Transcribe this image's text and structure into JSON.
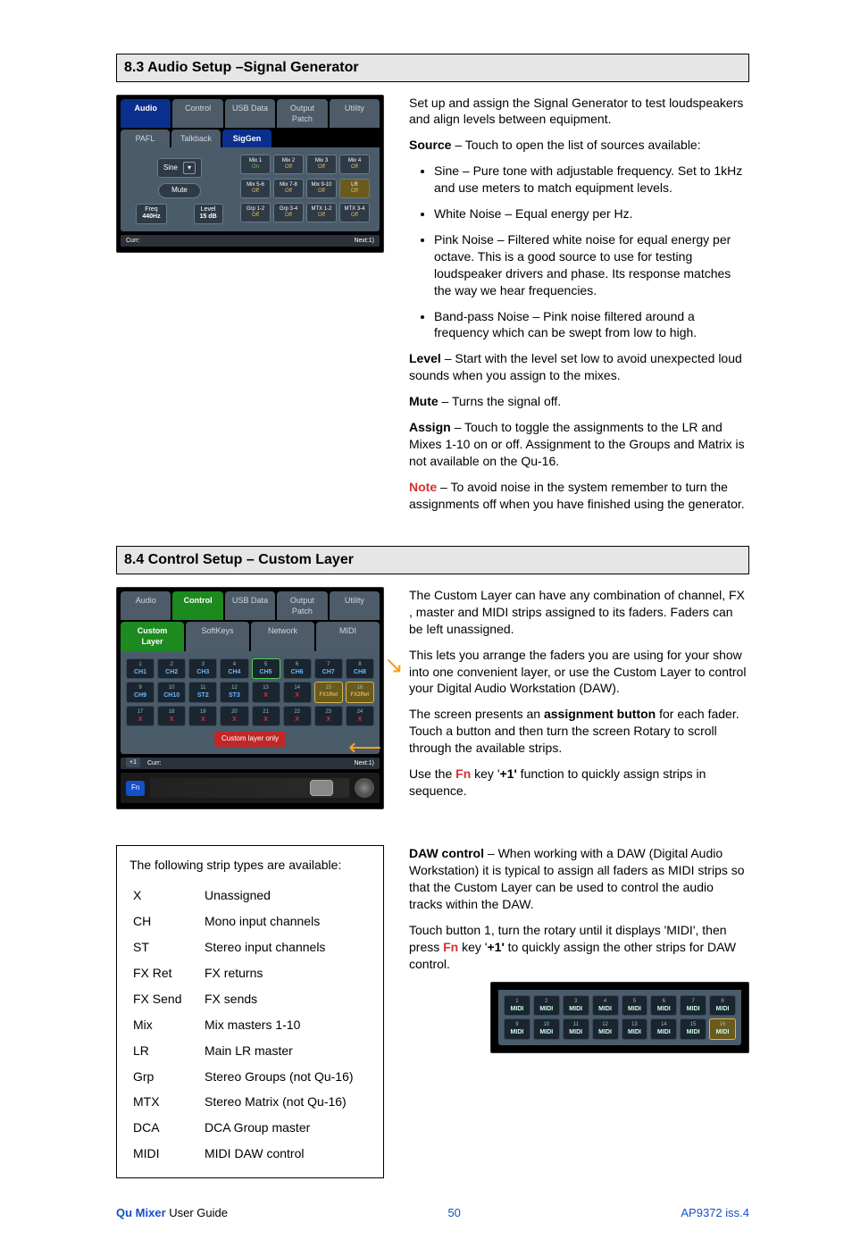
{
  "section83": {
    "heading": "8.3  Audio Setup –Signal Generator",
    "intro": "Set up and assign the Signal Generator to test loudspeakers and align levels between equipment.",
    "source_label": "Source",
    "source_text": " – Touch to open the list of sources available:",
    "bullets": [
      "Sine – Pure tone with adjustable frequency. Set to 1kHz and use meters to match equipment levels.",
      "White Noise – Equal energy per Hz.",
      "Pink Noise – Filtered white noise for equal energy per octave. This is a good source to use for testing loudspeaker drivers and phase. Its response matches the way we hear frequencies.",
      "Band-pass Noise – Pink noise filtered around a frequency which can be swept from low to high."
    ],
    "level_label": "Level",
    "level_text": " – Start with the level set low to avoid unexpected loud sounds when you assign to the mixes.",
    "mute_label": "Mute",
    "mute_text": " – Turns the signal off.",
    "assign_label": "Assign",
    "assign_text": " – Touch to toggle the assignments to the LR and Mixes 1-10 on or off. Assignment to the Groups and Matrix is not available on the Qu-16.",
    "note_label": "Note",
    "note_text": " – To avoid noise in the system remember to turn the assignments off when you have finished using the generator.",
    "ui": {
      "tabs_top": [
        "Audio",
        "Control",
        "USB Data",
        "Output Patch",
        "Utility"
      ],
      "tabs_sub": [
        "PAFL",
        "Talkback",
        "SigGen"
      ],
      "sine": "Sine",
      "mute": "Mute",
      "freq_label": "Freq",
      "freq_val": "440Hz",
      "level_label": "Level",
      "level_val": "15 dB",
      "mixes": [
        {
          "t": "Mix 1",
          "s": "On",
          "on": true
        },
        {
          "t": "Mix 2",
          "s": "Off",
          "on": false
        },
        {
          "t": "Mix 3",
          "s": "Off",
          "on": false
        },
        {
          "t": "Mix 4",
          "s": "Off",
          "on": false
        },
        {
          "t": "Mix 5-6",
          "s": "Off",
          "on": false
        },
        {
          "t": "Mix 7-8",
          "s": "Off",
          "on": false
        },
        {
          "t": "Mix 9-10",
          "s": "Off",
          "on": false
        },
        {
          "t": "LR",
          "s": "Off",
          "on": false,
          "lr": true
        },
        {
          "t": "Grp 1-2",
          "s": "Off",
          "on": false
        },
        {
          "t": "Grp 3-4",
          "s": "Off",
          "on": false
        },
        {
          "t": "MTX 1-2",
          "s": "Off",
          "on": false
        },
        {
          "t": "MTX 3-4",
          "s": "Off",
          "on": false
        }
      ],
      "footer_curr": "Curr:",
      "footer_next": "Next:1)"
    }
  },
  "section84": {
    "heading": "8.4  Control Setup – Custom Layer",
    "p1": "The Custom Layer can have any combination of channel, FX , master and MIDI strips assigned to its faders. Faders can be left unassigned.",
    "p2": "This lets you arrange the faders you are using for your show into one convenient layer, or use the Custom Layer to control your Digital Audio Workstation (DAW).",
    "p3a": "The screen presents an ",
    "p3b": "assignment button",
    "p3c": " for each fader. Touch a button and then turn the screen Rotary to scroll through the available strips.",
    "p4a": "Use the ",
    "p4_fn": "Fn",
    "p4b": " key '",
    "p4_plus": "+1'",
    "p4c": " function to quickly assign strips in sequence.",
    "daw_label": "DAW control",
    "daw_text": " – When working with a DAW (Digital Audio Workstation) it is typical to assign all faders as MIDI strips so that the Custom Layer can be used to control the audio tracks within the DAW.",
    "p6a": "Touch button 1, turn the rotary until it displays 'MIDI', then press ",
    "p6_fn": "Fn",
    "p6b": " key '",
    "p6_plus": "+1'",
    "p6c": " to quickly assign the other strips for DAW control.",
    "ui": {
      "tabs_top": [
        "Audio",
        "Control",
        "USB Data",
        "Output Patch",
        "Utility"
      ],
      "tabs_sub": [
        "Custom Layer",
        "SoftKeys",
        "Network",
        "MIDI"
      ],
      "cells": [
        {
          "n": "1",
          "l": "CH1",
          "c": "ch"
        },
        {
          "n": "2",
          "l": "CH2",
          "c": "ch"
        },
        {
          "n": "3",
          "l": "CH3",
          "c": "ch"
        },
        {
          "n": "4",
          "l": "CH4",
          "c": "ch"
        },
        {
          "n": "5",
          "l": "CH5",
          "c": "ch g"
        },
        {
          "n": "6",
          "l": "CH6",
          "c": "ch"
        },
        {
          "n": "7",
          "l": "CH7",
          "c": "ch"
        },
        {
          "n": "8",
          "l": "CH8",
          "c": "ch"
        },
        {
          "n": "9",
          "l": "CH9",
          "c": "ch"
        },
        {
          "n": "10",
          "l": "CH10",
          "c": "ch"
        },
        {
          "n": "11",
          "l": "ST2",
          "c": "st"
        },
        {
          "n": "12",
          "l": "ST3",
          "c": "st"
        },
        {
          "n": "13",
          "l": "X",
          "c": "x"
        },
        {
          "n": "14",
          "l": "X",
          "c": "x"
        },
        {
          "n": "15",
          "l": "FX1Ret",
          "c": "fx y"
        },
        {
          "n": "16",
          "l": "FX2Ret",
          "c": "fx y"
        },
        {
          "n": "17",
          "l": "X",
          "c": "x"
        },
        {
          "n": "18",
          "l": "X",
          "c": "x"
        },
        {
          "n": "19",
          "l": "X",
          "c": "x"
        },
        {
          "n": "20",
          "l": "X",
          "c": "x"
        },
        {
          "n": "21",
          "l": "X",
          "c": "x"
        },
        {
          "n": "22",
          "l": "X",
          "c": "x"
        },
        {
          "n": "23",
          "l": "X",
          "c": "x"
        },
        {
          "n": "24",
          "l": "X",
          "c": "x"
        }
      ],
      "only": "Custom layer only",
      "plus1": "+1",
      "fn": "Fn",
      "footer_curr": "Curr:",
      "footer_next": "Next:1)"
    },
    "types_intro": "The following strip types are available:",
    "types": [
      [
        "X",
        "Unassigned"
      ],
      [
        "CH",
        "Mono input channels"
      ],
      [
        "ST",
        "Stereo input channels"
      ],
      [
        "FX Ret",
        "FX returns"
      ],
      [
        "FX Send",
        "FX sends"
      ],
      [
        "Mix",
        "Mix masters 1-10"
      ],
      [
        "LR",
        "Main LR master"
      ],
      [
        "Grp",
        "Stereo Groups (not Qu-16)"
      ],
      [
        "MTX",
        "Stereo Matrix (not Qu-16)"
      ],
      [
        "DCA",
        "DCA Group master"
      ],
      [
        "MIDI",
        "MIDI DAW control"
      ]
    ],
    "midi_cells": [
      {
        "n": "1",
        "l": "MIDI"
      },
      {
        "n": "2",
        "l": "MIDI"
      },
      {
        "n": "3",
        "l": "MIDI"
      },
      {
        "n": "4",
        "l": "MIDI"
      },
      {
        "n": "5",
        "l": "MIDI"
      },
      {
        "n": "6",
        "l": "MIDI"
      },
      {
        "n": "7",
        "l": "MIDI"
      },
      {
        "n": "8",
        "l": "MIDI"
      },
      {
        "n": "9",
        "l": "MIDI"
      },
      {
        "n": "10",
        "l": "MIDI"
      },
      {
        "n": "11",
        "l": "MIDI"
      },
      {
        "n": "12",
        "l": "MIDI"
      },
      {
        "n": "13",
        "l": "MIDI"
      },
      {
        "n": "14",
        "l": "MIDI"
      },
      {
        "n": "15",
        "l": "MIDI"
      },
      {
        "n": "16",
        "l": "MIDI",
        "y": true
      }
    ]
  },
  "footer": {
    "product": "Qu Mixer",
    "guide": " User Guide",
    "page": "50",
    "rev": "AP9372 iss.4"
  }
}
